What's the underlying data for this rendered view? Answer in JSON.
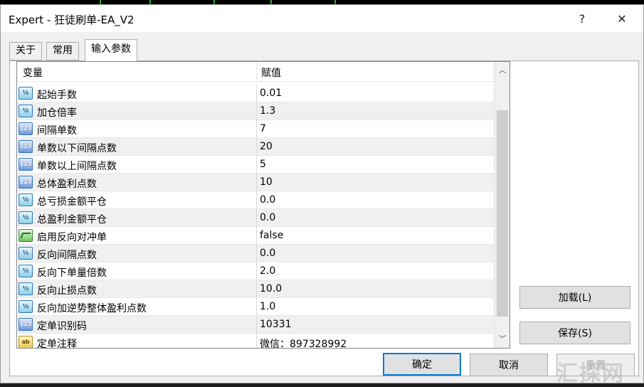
{
  "window": {
    "title": "Expert - 狂徒刷单-EA_V2",
    "help_label": "?",
    "close_label": "✕"
  },
  "tabs": [
    {
      "label": "关于",
      "active": false
    },
    {
      "label": "常用",
      "active": false
    },
    {
      "label": "输入参数",
      "active": true
    }
  ],
  "grid": {
    "col_variable": "变量",
    "col_value": "赋值",
    "rows": [
      {
        "icon": "double",
        "icon_text": "½",
        "name": "起始手数",
        "value": "0.01"
      },
      {
        "icon": "double",
        "icon_text": "½",
        "name": "加仓倍率",
        "value": "1.3"
      },
      {
        "icon": "int",
        "icon_text": "123",
        "name": "间隔单数",
        "value": "7"
      },
      {
        "icon": "int",
        "icon_text": "123",
        "name": "单数以下间隔点数",
        "value": "20"
      },
      {
        "icon": "int",
        "icon_text": "123",
        "name": "单数以上间隔点数",
        "value": "5"
      },
      {
        "icon": "int",
        "icon_text": "123",
        "name": "总体盈利点数",
        "value": "10"
      },
      {
        "icon": "double",
        "icon_text": "½",
        "name": "总亏损金额平仓",
        "value": "0.0"
      },
      {
        "icon": "double",
        "icon_text": "½",
        "name": "总盈利金额平仓",
        "value": "0.0"
      },
      {
        "icon": "bool",
        "icon_text": "",
        "name": "启用反向对冲单",
        "value": "false"
      },
      {
        "icon": "double",
        "icon_text": "½",
        "name": "反向间隔点数",
        "value": "0.0"
      },
      {
        "icon": "double",
        "icon_text": "½",
        "name": "反向下单量倍数",
        "value": "2.0"
      },
      {
        "icon": "double",
        "icon_text": "½",
        "name": "反向止损点数",
        "value": "10.0"
      },
      {
        "icon": "double",
        "icon_text": "½",
        "name": "反向加逆势整体盈利点数",
        "value": "1.0"
      },
      {
        "icon": "int",
        "icon_text": "123",
        "name": "定单识别码",
        "value": "10331"
      },
      {
        "icon": "string",
        "icon_text": "ab",
        "name": "定单注释",
        "value": "微信：897328992"
      }
    ]
  },
  "buttons": {
    "load": "加载(L)",
    "save": "保存(S)",
    "ok": "确定",
    "cancel": "取消",
    "reset": "重置"
  },
  "watermark": "汇探网"
}
